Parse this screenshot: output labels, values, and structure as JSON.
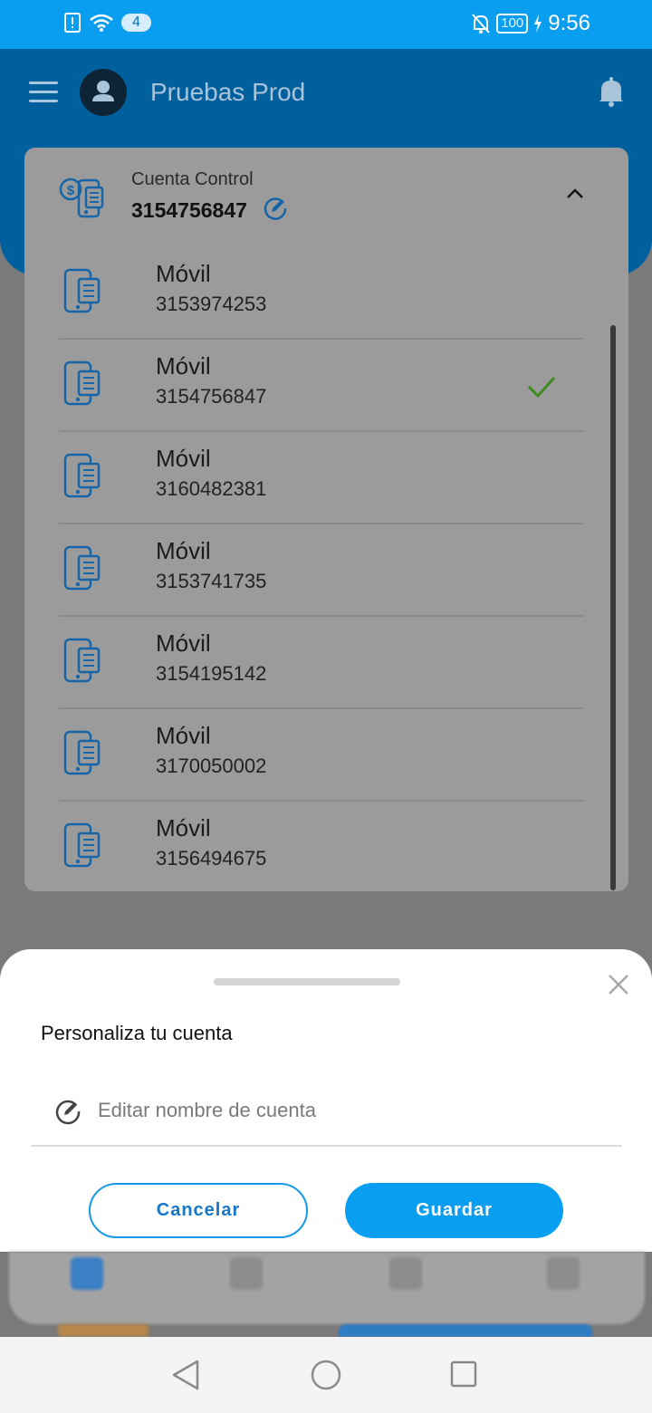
{
  "status_bar": {
    "time": "9:56",
    "notification_count": "4",
    "battery": "100"
  },
  "header": {
    "title": "Pruebas Prod"
  },
  "account": {
    "label": "Cuenta Control",
    "number": "3154756847",
    "lines": [
      {
        "name": "Móvil",
        "number": "3153974253",
        "selected": false
      },
      {
        "name": "Móvil",
        "number": "3154756847",
        "selected": true
      },
      {
        "name": "Móvil",
        "number": "3160482381",
        "selected": false
      },
      {
        "name": "Móvil",
        "number": "3153741735",
        "selected": false
      },
      {
        "name": "Móvil",
        "number": "3154195142",
        "selected": false
      },
      {
        "name": "Móvil",
        "number": "3170050002",
        "selected": false
      },
      {
        "name": "Móvil",
        "number": "3156494675",
        "selected": false
      }
    ]
  },
  "sheet": {
    "title": "Personaliza tu cuenta",
    "input_placeholder": "Editar nombre de cuenta",
    "input_value": "",
    "cancel_label": "Cancelar",
    "save_label": "Guardar"
  },
  "colors": {
    "primary": "#0a9ef0",
    "header_dark": "#00609e",
    "check_green": "#3d8a1e"
  }
}
